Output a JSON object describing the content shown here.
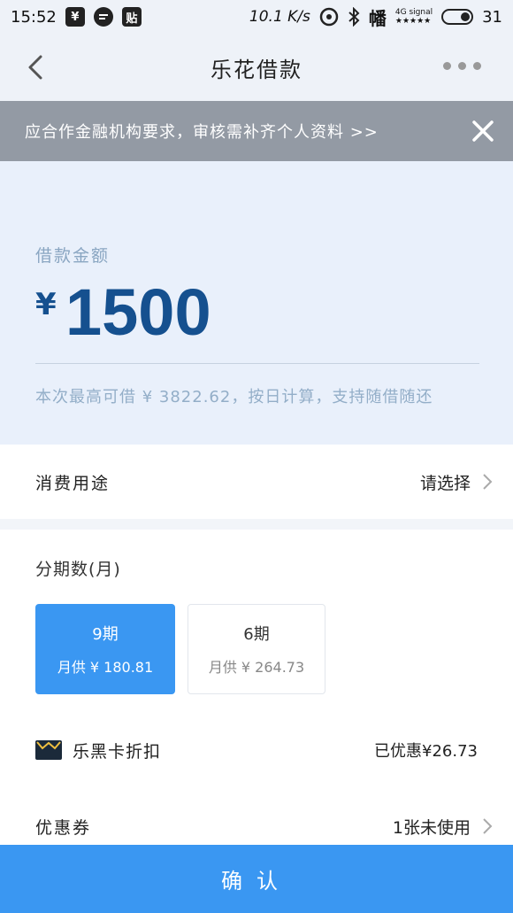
{
  "status_bar": {
    "time": "15:52",
    "left_icons": [
      "¥",
      "💬",
      "贴"
    ],
    "speed": "10.1 K/s",
    "signal_label": "4G signal",
    "signal_stars": "★★★★★",
    "battery": "31",
    "carrier_logo": "幡"
  },
  "nav": {
    "title": "乐花借款"
  },
  "notice": {
    "text": "应合作金融机构要求，审核需补齐个人资料 >>"
  },
  "amount": {
    "label": "借款金额",
    "currency": "¥",
    "value": "1500",
    "hint": "本次最高可借 ¥ 3822.62，按日计算，支持随借随还"
  },
  "purpose": {
    "label": "消费用途",
    "value": "请选择"
  },
  "term": {
    "title": "分期数(月)",
    "options": [
      {
        "period": "9期",
        "monthly": "月供 ¥ 180.81",
        "selected": true
      },
      {
        "period": "6期",
        "monthly": "月供 ¥ 264.73",
        "selected": false
      }
    ]
  },
  "card": {
    "label": "乐黑卡折扣",
    "discount": "已优惠¥26.73"
  },
  "coupon": {
    "label": "优惠券",
    "value": "1张未使用"
  },
  "confirm": {
    "label": "确认"
  },
  "colors": {
    "accent": "#3a97f2",
    "amount": "#15508f",
    "notice_bg": "#939aa4"
  }
}
